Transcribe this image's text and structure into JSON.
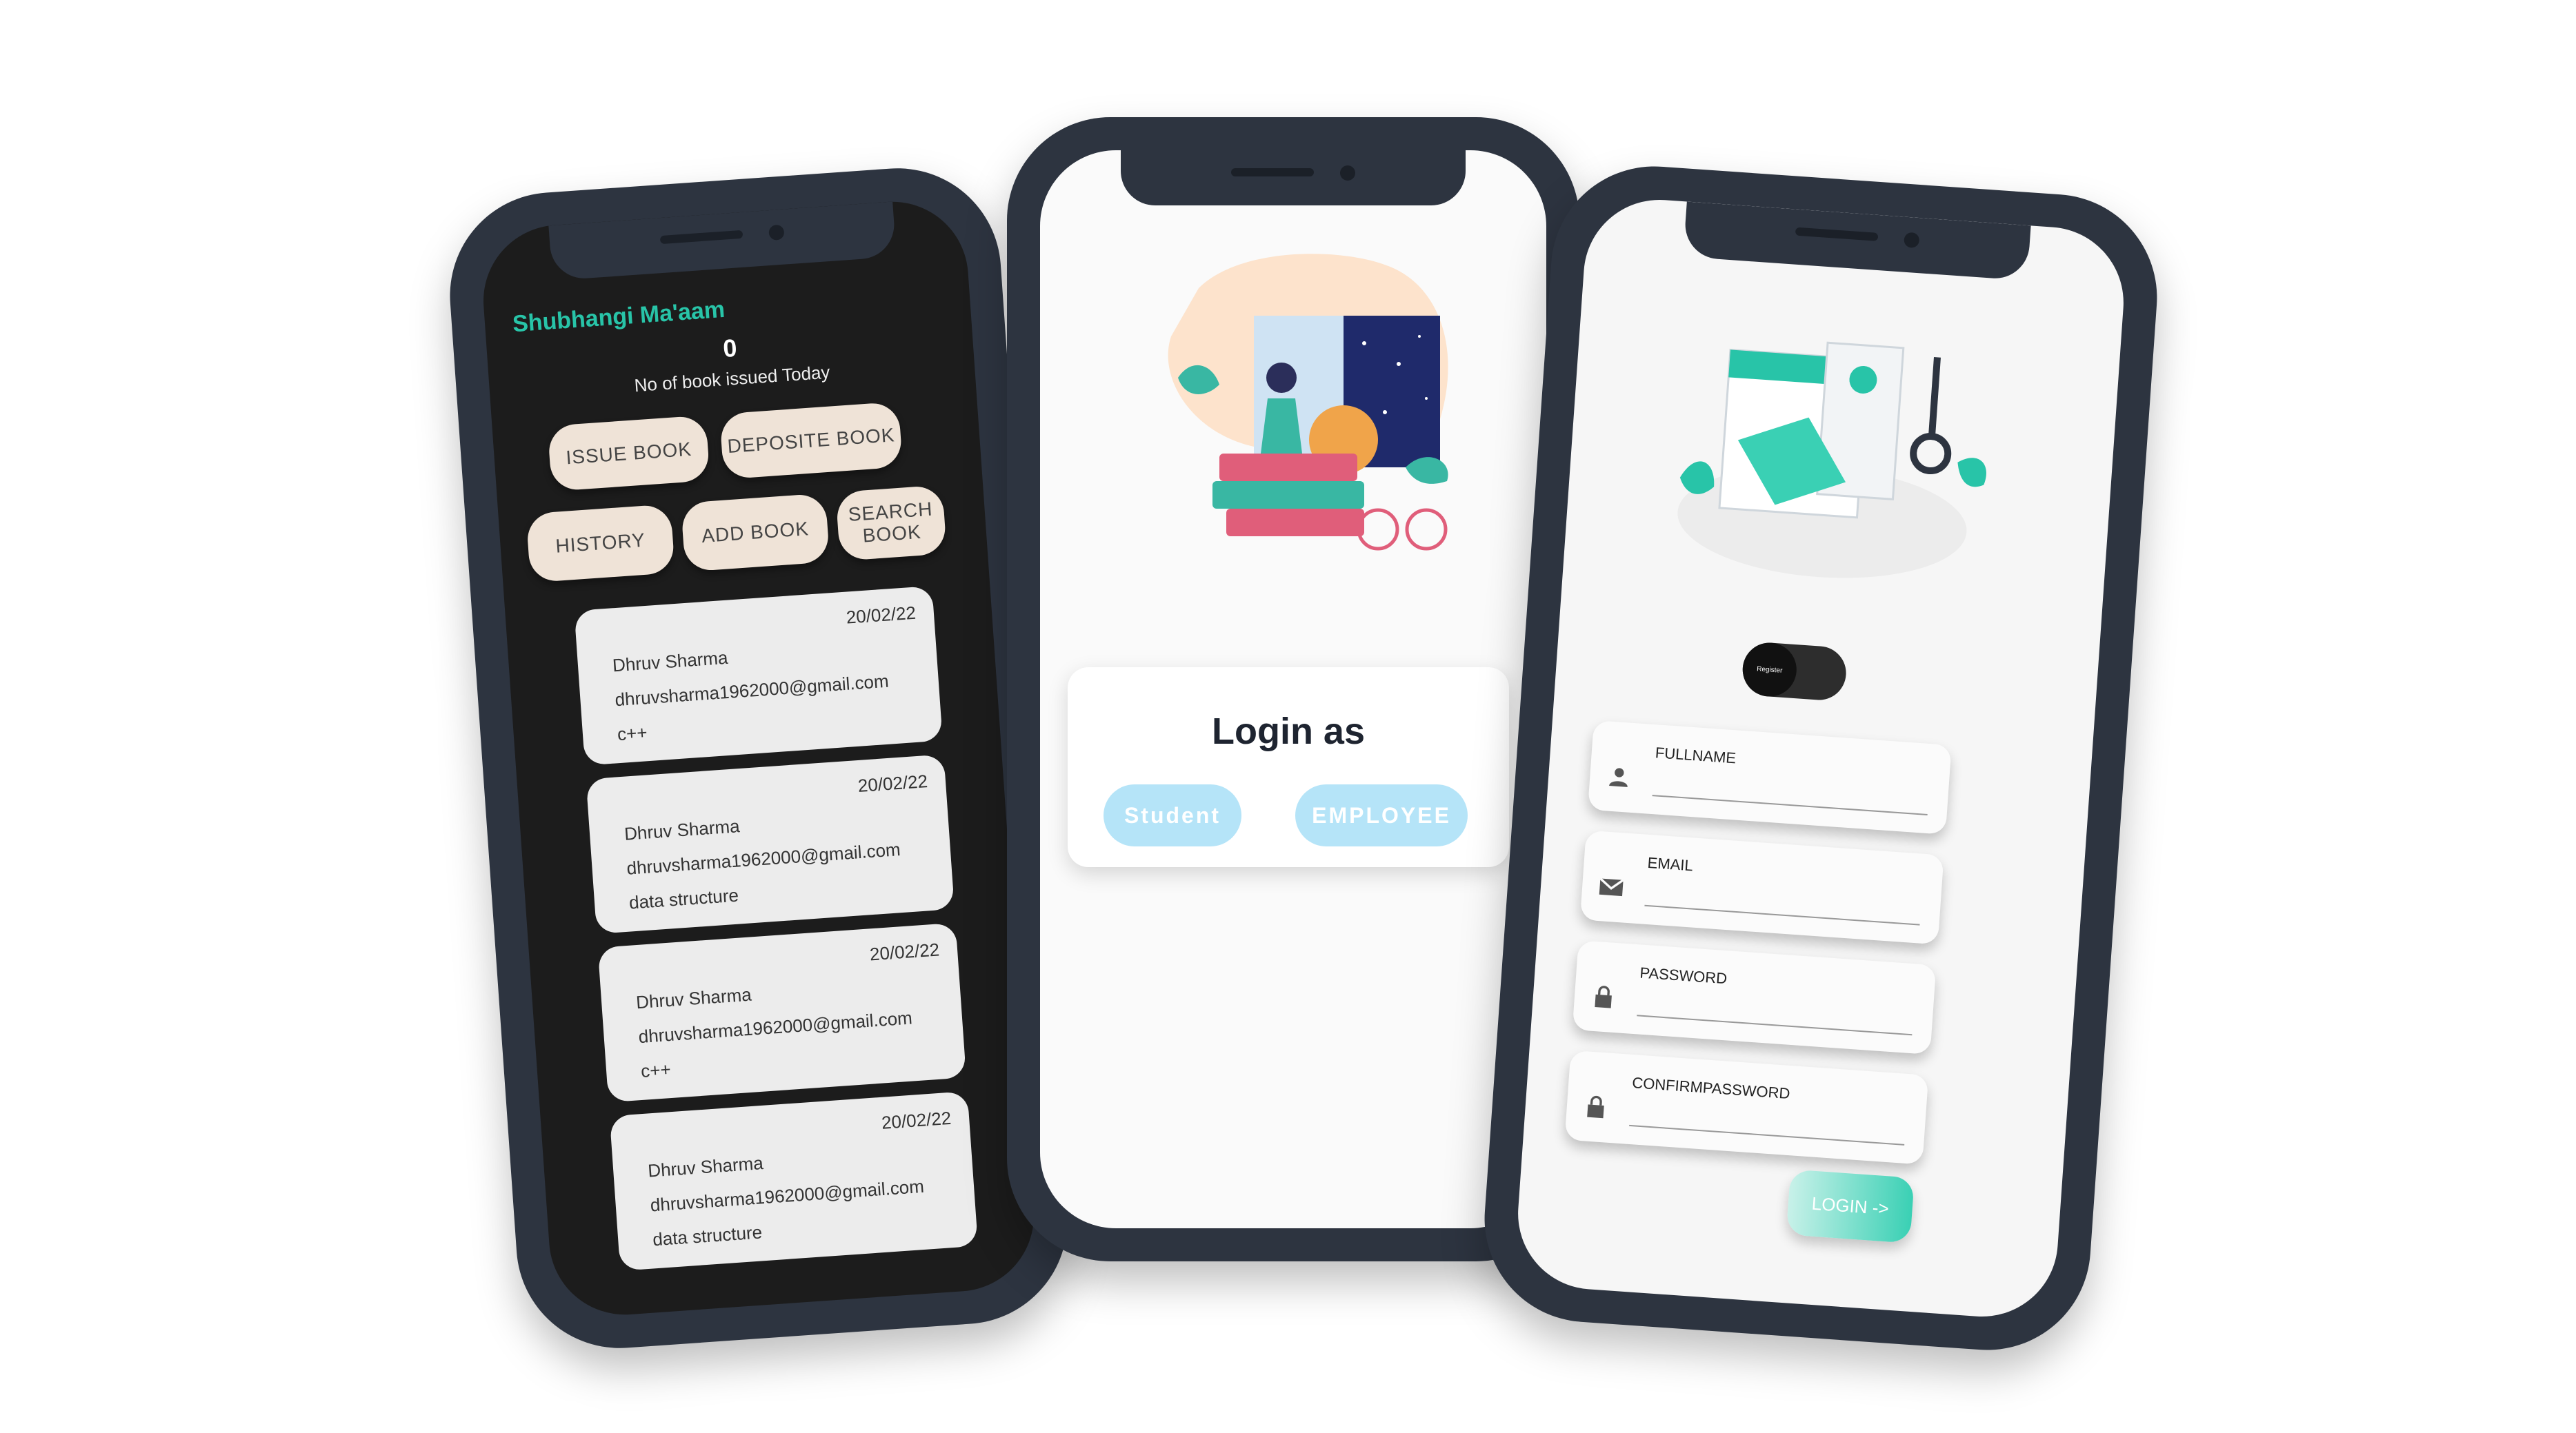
{
  "librarian_dashboard": {
    "user_name": "Shubhangi Ma'aam",
    "books_issued_count": "0",
    "books_issued_label": "No of book issued Today",
    "buttons": {
      "issue_book": "ISSUE BOOK",
      "deposite_book": "DEPOSITE BOOK",
      "history": "HISTORY",
      "add_book": "ADD BOOK",
      "search_book": "SEARCH BOOK"
    },
    "records": [
      {
        "date": "20/02/22",
        "name": "Dhruv Sharma",
        "email": "dhruvsharma1962000@gmail.com",
        "book": "c++"
      },
      {
        "date": "20/02/22",
        "name": "Dhruv Sharma",
        "email": "dhruvsharma1962000@gmail.com",
        "book": "data structure"
      },
      {
        "date": "20/02/22",
        "name": "Dhruv Sharma",
        "email": "dhruvsharma1962000@gmail.com",
        "book": "c++"
      },
      {
        "date": "20/02/22",
        "name": "Dhruv Sharma",
        "email": "dhruvsharma1962000@gmail.com",
        "book": "data structure"
      }
    ]
  },
  "login_screen": {
    "title": "Login as",
    "student_label": "Student",
    "employee_label": "EMPLOYEE",
    "colors": {
      "button": "#b5e4f8",
      "title": "#1e2430"
    }
  },
  "register_screen": {
    "toggle_label": "Register",
    "fields": [
      {
        "label": "FULLNAME",
        "icon": "person-icon"
      },
      {
        "label": "EMAIL",
        "icon": "mail-icon"
      },
      {
        "label": "PASSWORD",
        "icon": "lock-icon"
      },
      {
        "label": "CONFIRMPASSWORD",
        "icon": "lock-icon"
      }
    ],
    "login_button": "LOGIN ->",
    "colors": {
      "accent": "#3ad0b4"
    }
  },
  "colors": {
    "phone_frame": "#2d3440",
    "dark_bg": "#1c1c1c",
    "pill": "#efe3d7",
    "teal": "#28c4a8"
  }
}
